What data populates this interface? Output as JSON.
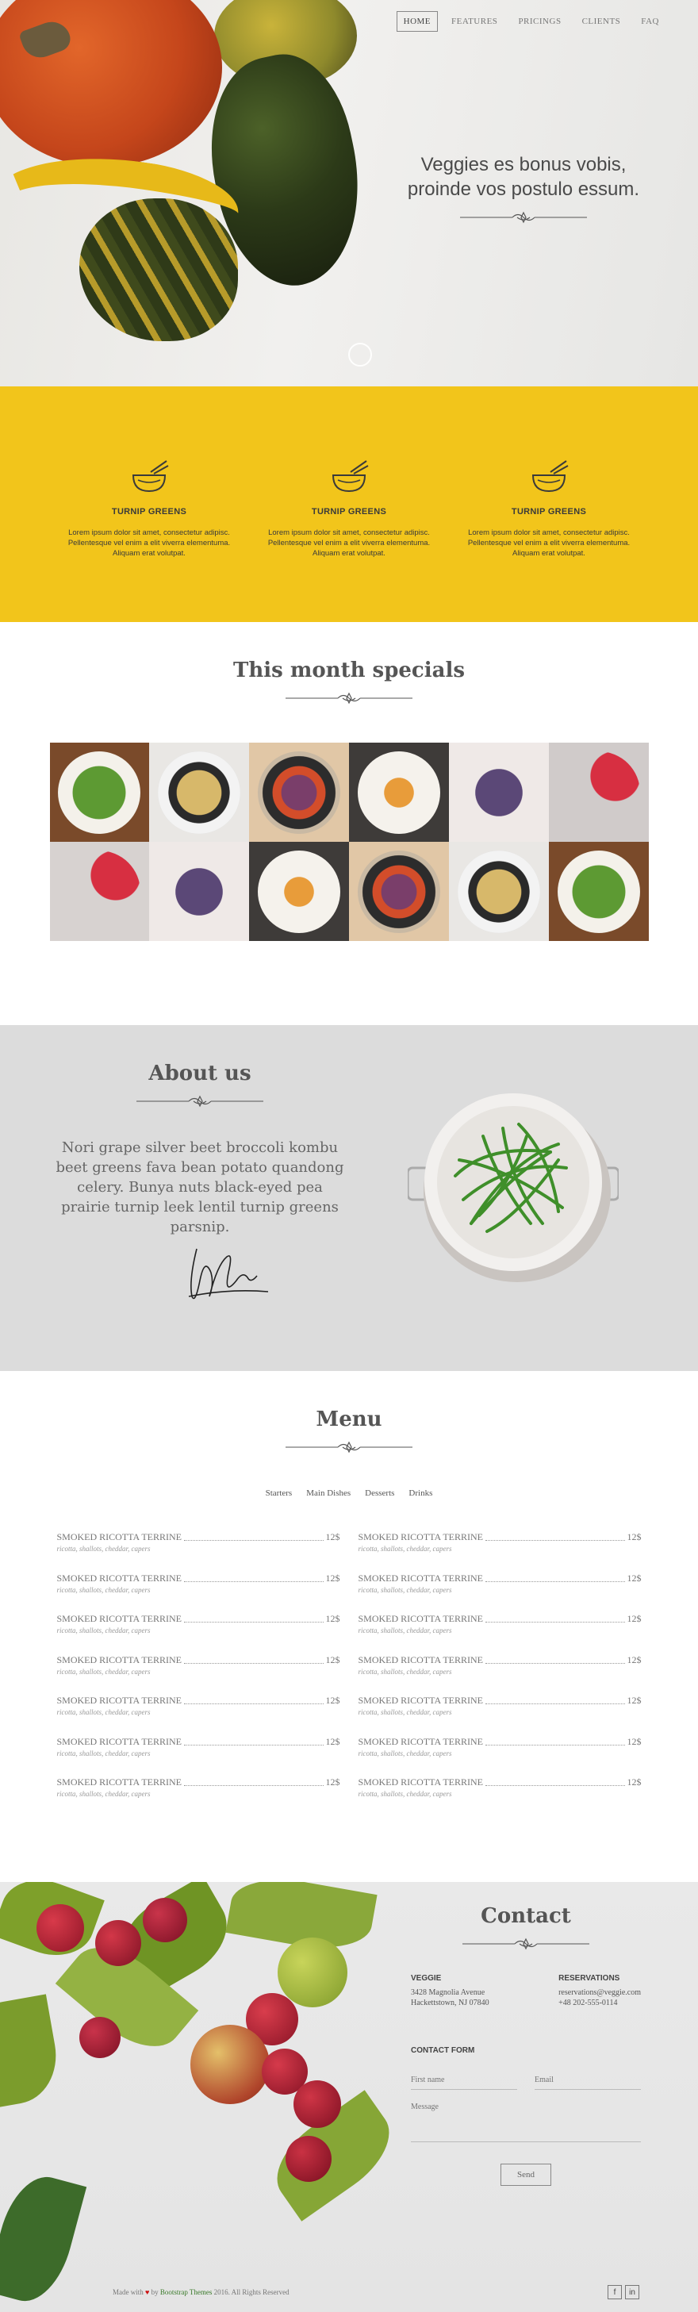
{
  "nav": {
    "items": [
      "HOME",
      "FEATURES",
      "PRICINGS",
      "CLIENTS",
      "FAQ"
    ]
  },
  "hero": {
    "line1": "Veggies es bonus vobis,",
    "line2": "proinde vos postulo essum."
  },
  "features": [
    {
      "title": "TURNIP GREENS",
      "text": "Lorem ipsum dolor sit amet, consectetur adipisc. Pellentesque vel enim a elit viverra elementuma. Aliquam erat volutpat."
    },
    {
      "title": "TURNIP GREENS",
      "text": "Lorem ipsum dolor sit amet, consectetur adipisc. Pellentesque vel enim a elit viverra elementuma. Aliquam erat volutpat."
    },
    {
      "title": "TURNIP GREENS",
      "text": "Lorem ipsum dolor sit amet, consectetur adipisc. Pellentesque vel enim a elit viverra elementuma. Aliquam erat volutpat."
    }
  ],
  "specials": {
    "title": "This month specials"
  },
  "about": {
    "title": "About us",
    "text": "Nori grape silver beet broccoli kombu beet greens fava bean potato quandong celery. Bunya nuts black-eyed pea prairie turnip leek lentil turnip greens parsnip."
  },
  "menu": {
    "title": "Menu",
    "tabs": [
      "Starters",
      "Main Dishes",
      "Desserts",
      "Drinks"
    ],
    "left": [
      {
        "name": "SMOKED RICOTTA TERRINE",
        "price": "12$",
        "desc": "ricotta, shallots, cheddar, capers"
      },
      {
        "name": "SMOKED RICOTTA TERRINE",
        "price": "12$",
        "desc": "ricotta, shallots, cheddar, capers"
      },
      {
        "name": "SMOKED RICOTTA TERRINE",
        "price": "12$",
        "desc": "ricotta, shallots, cheddar, capers"
      },
      {
        "name": "SMOKED RICOTTA TERRINE",
        "price": "12$",
        "desc": "ricotta, shallots, cheddar, capers"
      },
      {
        "name": "SMOKED RICOTTA TERRINE",
        "price": "12$",
        "desc": "ricotta, shallots, cheddar, capers"
      },
      {
        "name": "SMOKED RICOTTA TERRINE",
        "price": "12$",
        "desc": "ricotta, shallots, cheddar, capers"
      },
      {
        "name": "SMOKED RICOTTA TERRINE",
        "price": "12$",
        "desc": "ricotta, shallots, cheddar, capers"
      }
    ],
    "right": [
      {
        "name": "SMOKED RICOTTA TERRINE",
        "price": "12$",
        "desc": "ricotta, shallots, cheddar, capers"
      },
      {
        "name": "SMOKED RICOTTA TERRINE",
        "price": "12$",
        "desc": "ricotta, shallots, cheddar, capers"
      },
      {
        "name": "SMOKED RICOTTA TERRINE",
        "price": "12$",
        "desc": "ricotta, shallots, cheddar, capers"
      },
      {
        "name": "SMOKED RICOTTA TERRINE",
        "price": "12$",
        "desc": "ricotta, shallots, cheddar, capers"
      },
      {
        "name": "SMOKED RICOTTA TERRINE",
        "price": "12$",
        "desc": "ricotta, shallots, cheddar, capers"
      },
      {
        "name": "SMOKED RICOTTA TERRINE",
        "price": "12$",
        "desc": "ricotta, shallots, cheddar, capers"
      },
      {
        "name": "SMOKED RICOTTA TERRINE",
        "price": "12$",
        "desc": "ricotta, shallots, cheddar, capers"
      }
    ]
  },
  "contact": {
    "title": "Contact",
    "veggie_title": "VEGGIE",
    "veggie_address1": "3428 Magnolia Avenue",
    "veggie_address2": "Hackettstown, NJ 07840",
    "reservations_title": "RESERVATIONS",
    "reservations_email": "reservations@veggie.com",
    "reservations_phone": "+48 202-555-0114",
    "form_title": "CONTACT FORM",
    "first_name_placeholder": "First name",
    "email_placeholder": "Email",
    "message_placeholder": "Message",
    "send_label": "Send"
  },
  "footer": {
    "made_with": "Made with",
    "heart": "♥",
    "by": "by",
    "link": "Bootstrap Themes",
    "rights": "2016. All Rights Reserved",
    "facebook": "f",
    "linkedin": "in"
  },
  "colors": {
    "yellow": "#f2c51b",
    "about_bg": "#dcdcdc"
  }
}
